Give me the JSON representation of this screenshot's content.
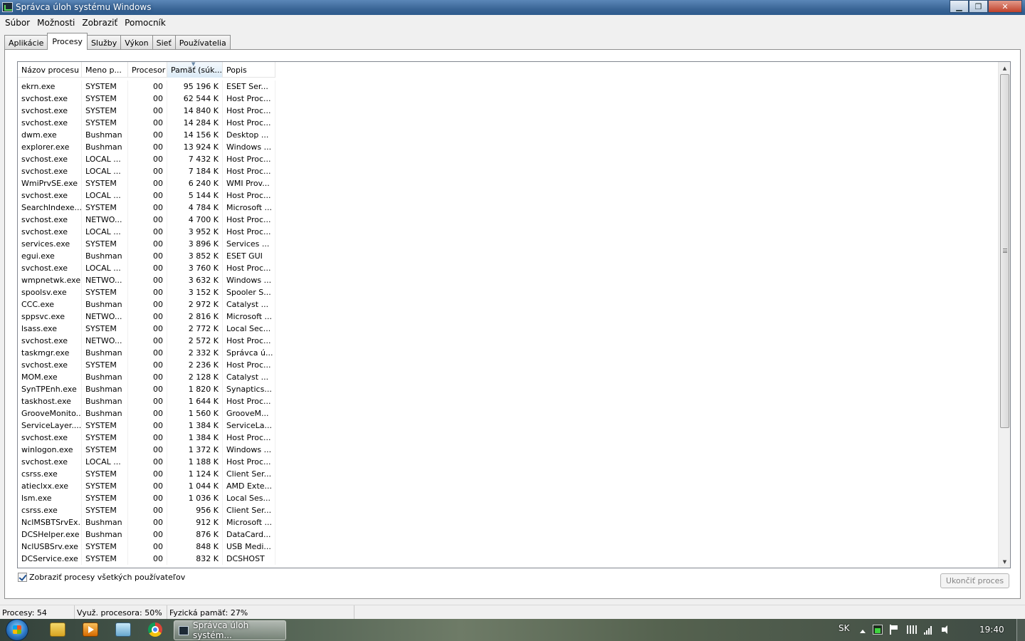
{
  "window": {
    "title": "Správca úloh systému Windows"
  },
  "menu": [
    "Súbor",
    "Možnosti",
    "Zobraziť",
    "Pomocník"
  ],
  "tabs": [
    {
      "label": "Aplikácie",
      "active": false
    },
    {
      "label": "Procesy",
      "active": true
    },
    {
      "label": "Služby",
      "active": false
    },
    {
      "label": "Výkon",
      "active": false
    },
    {
      "label": "Sieť",
      "active": false
    },
    {
      "label": "Používatelia",
      "active": false
    }
  ],
  "columns": [
    "Názov procesu",
    "Meno p...",
    "Procesor",
    "Pamäť (súk...",
    "Popis"
  ],
  "processes": [
    [
      "ekrn.exe",
      "SYSTEM",
      "00",
      "95 196 K",
      "ESET Ser..."
    ],
    [
      "svchost.exe",
      "SYSTEM",
      "00",
      "62 544 K",
      "Host Proc..."
    ],
    [
      "svchost.exe",
      "SYSTEM",
      "00",
      "14 840 K",
      "Host Proc..."
    ],
    [
      "svchost.exe",
      "SYSTEM",
      "00",
      "14 284 K",
      "Host Proc..."
    ],
    [
      "dwm.exe",
      "Bushman",
      "00",
      "14 156 K",
      "Desktop ..."
    ],
    [
      "explorer.exe",
      "Bushman",
      "00",
      "13 924 K",
      "Windows ..."
    ],
    [
      "svchost.exe",
      "LOCAL ...",
      "00",
      "7 432 K",
      "Host Proc..."
    ],
    [
      "svchost.exe",
      "LOCAL ...",
      "00",
      "7 184 K",
      "Host Proc..."
    ],
    [
      "WmiPrvSE.exe",
      "SYSTEM",
      "00",
      "6 240 K",
      "WMI Prov..."
    ],
    [
      "svchost.exe",
      "LOCAL ...",
      "00",
      "5 144 K",
      "Host Proc..."
    ],
    [
      "SearchIndexe...",
      "SYSTEM",
      "00",
      "4 784 K",
      "Microsoft ..."
    ],
    [
      "svchost.exe",
      "NETWO...",
      "00",
      "4 700 K",
      "Host Proc..."
    ],
    [
      "svchost.exe",
      "LOCAL ...",
      "00",
      "3 952 K",
      "Host Proc..."
    ],
    [
      "services.exe",
      "SYSTEM",
      "00",
      "3 896 K",
      "Services ..."
    ],
    [
      "egui.exe",
      "Bushman",
      "00",
      "3 852 K",
      "ESET GUI"
    ],
    [
      "svchost.exe",
      "LOCAL ...",
      "00",
      "3 760 K",
      "Host Proc..."
    ],
    [
      "wmpnetwk.exe",
      "NETWO...",
      "00",
      "3 632 K",
      "Windows ..."
    ],
    [
      "spoolsv.exe",
      "SYSTEM",
      "00",
      "3 152 K",
      "Spooler S..."
    ],
    [
      "CCC.exe",
      "Bushman",
      "00",
      "2 972 K",
      "Catalyst ..."
    ],
    [
      "sppsvc.exe",
      "NETWO...",
      "00",
      "2 816 K",
      "Microsoft ..."
    ],
    [
      "lsass.exe",
      "SYSTEM",
      "00",
      "2 772 K",
      "Local Sec..."
    ],
    [
      "svchost.exe",
      "NETWO...",
      "00",
      "2 572 K",
      "Host Proc..."
    ],
    [
      "taskmgr.exe",
      "Bushman",
      "00",
      "2 332 K",
      "Správca ú..."
    ],
    [
      "svchost.exe",
      "SYSTEM",
      "00",
      "2 236 K",
      "Host Proc..."
    ],
    [
      "MOM.exe",
      "Bushman",
      "00",
      "2 128 K",
      "Catalyst ..."
    ],
    [
      "SynTPEnh.exe",
      "Bushman",
      "00",
      "1 820 K",
      "Synaptics..."
    ],
    [
      "taskhost.exe",
      "Bushman",
      "00",
      "1 644 K",
      "Host Proc..."
    ],
    [
      "GrooveMonito...",
      "Bushman",
      "00",
      "1 560 K",
      "GrooveM..."
    ],
    [
      "ServiceLayer....",
      "SYSTEM",
      "00",
      "1 384 K",
      "ServiceLa..."
    ],
    [
      "svchost.exe",
      "SYSTEM",
      "00",
      "1 384 K",
      "Host Proc..."
    ],
    [
      "winlogon.exe",
      "SYSTEM",
      "00",
      "1 372 K",
      "Windows ..."
    ],
    [
      "svchost.exe",
      "LOCAL ...",
      "00",
      "1 188 K",
      "Host Proc..."
    ],
    [
      "csrss.exe",
      "SYSTEM",
      "00",
      "1 124 K",
      "Client Ser..."
    ],
    [
      "atieclxx.exe",
      "SYSTEM",
      "00",
      "1 044 K",
      "AMD Exte..."
    ],
    [
      "lsm.exe",
      "SYSTEM",
      "00",
      "1 036 K",
      "Local Ses..."
    ],
    [
      "csrss.exe",
      "SYSTEM",
      "00",
      "956 K",
      "Client Ser..."
    ],
    [
      "NclMSBTSrvEx...",
      "Bushman",
      "00",
      "912 K",
      "Microsoft ..."
    ],
    [
      "DCSHelper.exe",
      "Bushman",
      "00",
      "876 K",
      "DataCard..."
    ],
    [
      "NclUSBSrv.exe",
      "SYSTEM",
      "00",
      "848 K",
      "USB Medi..."
    ],
    [
      "DCService.exe",
      "SYSTEM",
      "00",
      "832 K",
      "DCSHOST"
    ]
  ],
  "controls": {
    "show_all_label": "Zobraziť procesy všetkých používateľov",
    "show_all_checked": true,
    "end_process_label": "Ukončiť proces"
  },
  "status": {
    "processes": "Procesy: 54",
    "cpu": "Využ. procesora: 50%",
    "memory": "Fyzická pamäť: 27%"
  },
  "taskbar": {
    "task_label": "Správca úloh systém...",
    "language": "SK",
    "clock": "19:40"
  },
  "colors": {
    "titlebar": "#3a6596",
    "window_bg": "#f0f0f0",
    "sorted_header": "#dbeaf6"
  }
}
